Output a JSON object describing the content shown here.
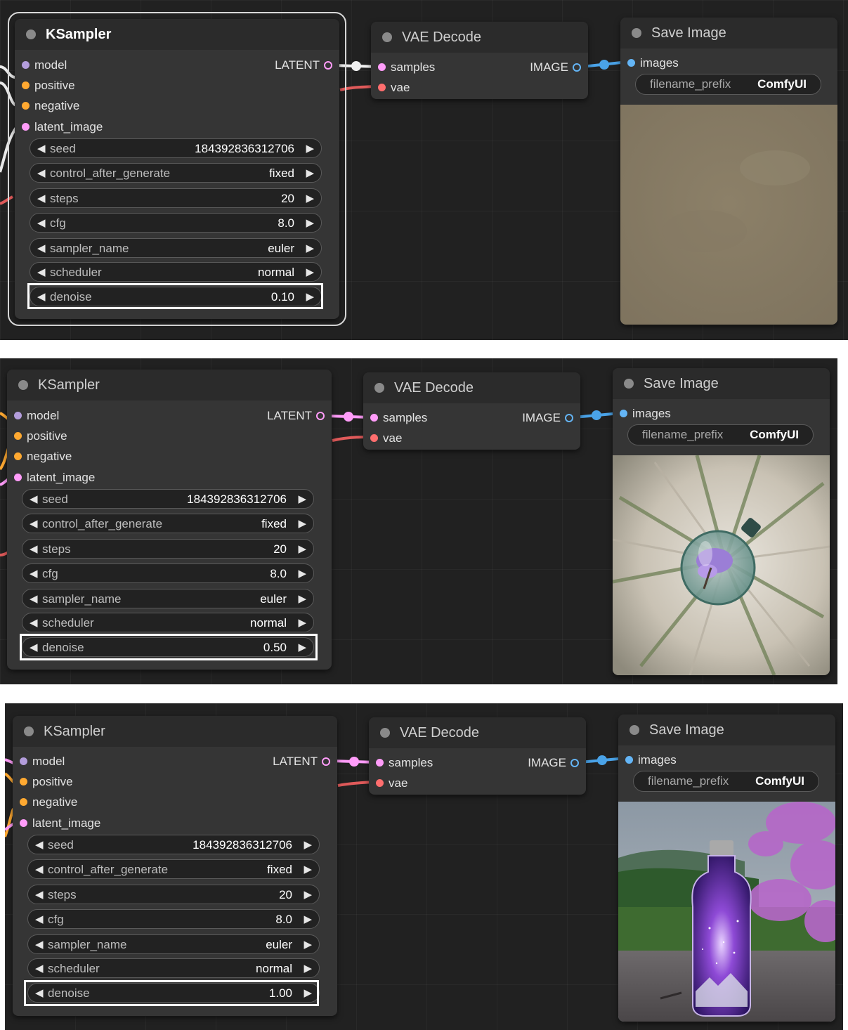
{
  "ksampler": {
    "title": "KSampler",
    "inputs": {
      "model": "model",
      "positive": "positive",
      "negative": "negative",
      "latent_image": "latent_image"
    },
    "output": "LATENT",
    "widgets": {
      "seed": {
        "name": "seed",
        "value": "184392836312706"
      },
      "control_after_generate": {
        "name": "control_after_generate",
        "value": "fixed"
      },
      "steps": {
        "name": "steps",
        "value": "20"
      },
      "cfg": {
        "name": "cfg",
        "value": "8.0"
      },
      "sampler_name": {
        "name": "sampler_name",
        "value": "euler"
      },
      "scheduler": {
        "name": "scheduler",
        "value": "normal"
      },
      "denoise": {
        "name": "denoise"
      }
    }
  },
  "vae_decode": {
    "title": "VAE Decode",
    "inputs": {
      "samples": "samples",
      "vae": "vae"
    },
    "output": "IMAGE"
  },
  "save_image": {
    "title": "Save Image",
    "input": "images",
    "filename_prefix": {
      "name": "filename_prefix",
      "value": "ComfyUI"
    }
  },
  "widget_arrows": {
    "left": "◀",
    "right": "▶"
  },
  "panels": [
    {
      "denoise_value": "0.10",
      "preview": "blank-beige",
      "ksampler_selected": true
    },
    {
      "denoise_value": "0.50",
      "preview": "bottle-in-rock-swirl",
      "ksampler_selected": false
    },
    {
      "denoise_value": "1.00",
      "preview": "galaxy-bottle-landscape",
      "ksampler_selected": false
    }
  ],
  "colors": {
    "canvas": "#212121",
    "node_body": "#353535",
    "node_title": "#2b2b2b",
    "model_slot": "#b39ddb",
    "conditioning_slot": "#ffa931",
    "latent_slot": "#ff9cf9",
    "vae_slot": "#ff6e6e",
    "image_slot": "#64b5f6",
    "highlight": "#ffffff"
  }
}
